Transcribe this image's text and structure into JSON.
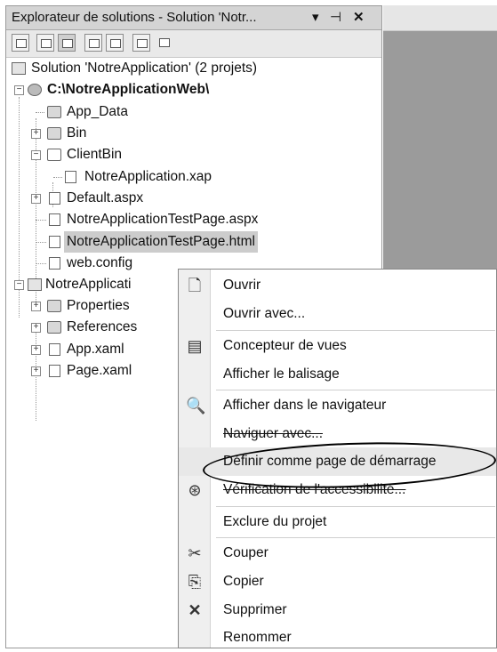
{
  "panel": {
    "title": "Explorateur de solutions - Solution 'Notr...",
    "pin_icon": "▾",
    "dock_icon": "⊣",
    "close_icon": "✕"
  },
  "toolbar": {
    "icons": [
      "properties-icon",
      "refresh-icon",
      "show-all-files-icon",
      "view-code-icon",
      "view-designer-icon",
      "nest-files-icon",
      "class-diagram-icon"
    ]
  },
  "tree": {
    "solution": "Solution 'NotreApplication' (2 projets)",
    "web_project": "C:\\NotreApplicationWeb\\",
    "app_data": "App_Data",
    "bin": "Bin",
    "clientbin": "ClientBin",
    "xap": "NotreApplication.xap",
    "default": "Default.aspx",
    "testpage_aspx": "NotreApplicationTestPage.aspx",
    "testpage_html": "NotreApplicationTestPage.html",
    "webconfig": "web.config",
    "sl_project": "NotreApplicati",
    "properties": "Properties",
    "references": "References",
    "appxaml": "App.xaml",
    "pagexaml": "Page.xaml"
  },
  "context_menu": {
    "open": "Ouvrir",
    "open_with": "Ouvrir avec...",
    "view_designer": "Concepteur de vues",
    "view_markup": "Afficher le balisage",
    "view_in_browser": "Afficher dans le navigateur",
    "browse_with": "Naviguer avec...",
    "set_start_page": "Définir comme page de démarrage",
    "check_accessibility": "Vérification de l'accessibilité...",
    "exclude": "Exclure du projet",
    "cut": "Couper",
    "copy": "Copier",
    "delete": "Supprimer",
    "rename": "Renommer"
  }
}
